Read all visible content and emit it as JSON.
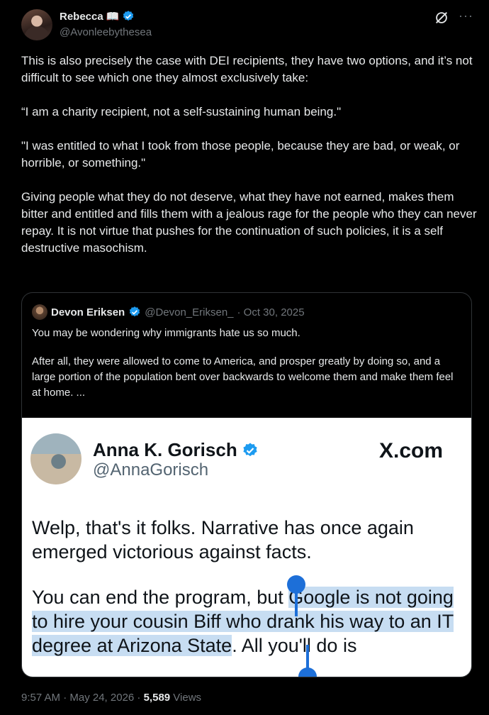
{
  "author": {
    "name": "Rebecca",
    "name_emoji": "📖",
    "handle": "@Avonleebythesea"
  },
  "post": {
    "paragraphs": [
      "This is also precisely the case with DEI recipients, they have two options, and it’s not difficult to see which one they almost exclusively take:",
      "“I am a charity recipient, not a self-sustaining human being.\"",
      "\"I was entitled to what I took from those people, because they are bad, or weak, or horrible, or something.\"",
      "Giving people what they do not deserve, what they have not earned, makes them bitter and entitled and fills them with a jealous rage for the people who they can never repay. It is not virtue that pushes for the continuation of such policies, it is a self destructive masochism."
    ]
  },
  "quote": {
    "name": "Devon Eriksen",
    "handle": "@Devon_Eriksen_",
    "date": "· Oct 30, 2025",
    "paragraphs": [
      "You may be wondering why immigrants hate us so much.",
      "After all, they were allowed to come to America, and prosper greatly by doing so, and a large portion of the population bent over backwards to welcome them and make them feel at home. ..."
    ],
    "image": {
      "name": "Anna K. Gorisch",
      "handle": "@AnnaGorisch",
      "brand": "X.com",
      "para1": "Welp, that's it folks. Narrative has once again emerged victorious against facts.",
      "para2_before": "You can end the program, but ",
      "para2_highlight": "Google is not going to hire your cousin Biff who drank his way to an IT degree at Arizona State",
      "para2_after": ". All you'll do is"
    }
  },
  "footer": {
    "time_date": "9:57 AM · May 24, 2026 · ",
    "views_count": "5,589",
    "views_label": " Views"
  },
  "colors": {
    "background": "#000000",
    "text": "#e7e9ea",
    "muted": "#71767b",
    "verified": "#1d9bf0",
    "selection": "#c7ddf2",
    "selection_handle": "#1d6fd8"
  },
  "icons": [
    "verified-badge-icon",
    "grok-icon",
    "more-options-icon"
  ]
}
